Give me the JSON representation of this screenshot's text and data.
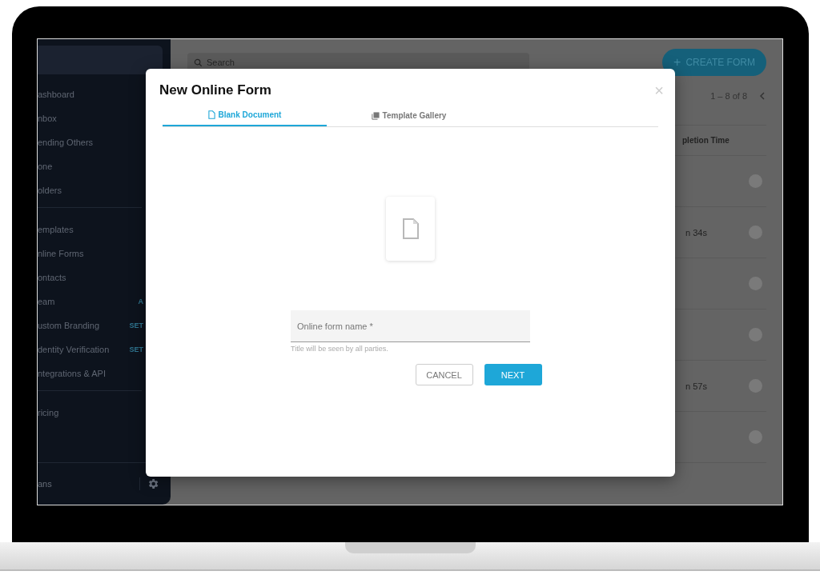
{
  "sidebar": {
    "items": [
      {
        "label": "ashboard"
      },
      {
        "label": "nbox"
      },
      {
        "label": "ending Others"
      },
      {
        "label": "one"
      },
      {
        "label": "olders",
        "divider_after": true
      },
      {
        "label": "emplates"
      },
      {
        "label": "nline Forms"
      },
      {
        "label": "ontacts"
      },
      {
        "label": "eam",
        "badge": "A"
      },
      {
        "label": "ustom Branding",
        "badge": "SET"
      },
      {
        "label": "dentity Verification",
        "badge": "SET"
      },
      {
        "label": "ntegrations & API",
        "divider_after": true
      },
      {
        "label": "ricing"
      }
    ],
    "user": {
      "name": "ans"
    }
  },
  "toolbar": {
    "search": {
      "placeholder": "Search"
    },
    "create_button": {
      "icon": "+",
      "label": "CREATE FORM"
    },
    "pagination": "1 – 8 of 8"
  },
  "table": {
    "columns": [
      "pletion Time"
    ],
    "rows": [
      {},
      {
        "column_1": "n 34s"
      },
      {},
      {},
      {
        "column_1": "n 57s"
      },
      {}
    ]
  },
  "dialog": {
    "title": "New Online Form",
    "close": "×",
    "tabs": [
      {
        "label": "Blank Document",
        "selected": true
      },
      {
        "label": "Template Gallery",
        "selected": false
      }
    ],
    "field": {
      "placeholder": "Online form name *",
      "hint": "Title will be seen by all parties."
    },
    "buttons": [
      {
        "label": "CANCEL",
        "kind": "outline"
      },
      {
        "label": "NEXT",
        "kind": "primary"
      }
    ]
  }
}
